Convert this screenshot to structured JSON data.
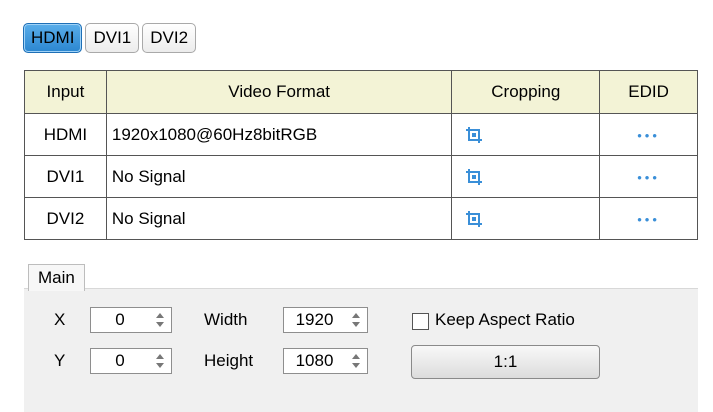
{
  "tabs": [
    {
      "label": "HDMI",
      "active": true
    },
    {
      "label": "DVI1",
      "active": false
    },
    {
      "label": "DVI2",
      "active": false
    }
  ],
  "table": {
    "headers": [
      "Input",
      "Video Format",
      "Cropping",
      "EDID"
    ],
    "rows": [
      {
        "input": "HDMI",
        "format": "1920x1080@60Hz8bitRGB",
        "crop_icon": "crop-icon",
        "edid": "•••"
      },
      {
        "input": "DVI1",
        "format": "No Signal",
        "crop_icon": "crop-icon",
        "edid": "•••"
      },
      {
        "input": "DVI2",
        "format": "No Signal",
        "crop_icon": "crop-icon",
        "edid": "•••"
      }
    ]
  },
  "panel": {
    "tab_label": "Main",
    "x_label": "X",
    "x_value": "0",
    "y_label": "Y",
    "y_value": "0",
    "width_label": "Width",
    "width_value": "1920",
    "height_label": "Height",
    "height_value": "1080",
    "keep_aspect_label": "Keep Aspect Ratio",
    "keep_aspect_checked": false,
    "ratio_button_label": "1:1"
  },
  "colors": {
    "active_tab": "#2b86d0",
    "header_bg": "#f3f3d6",
    "icon_blue": "#3a8fd8"
  }
}
